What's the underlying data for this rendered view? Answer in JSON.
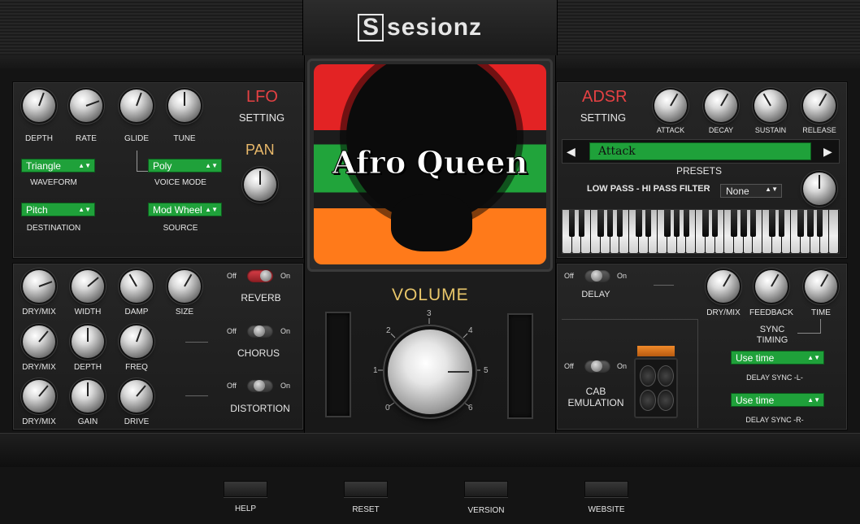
{
  "brand": {
    "logo_s": "S",
    "logo_text": "sesionz"
  },
  "lfo": {
    "title": "LFO",
    "subtitle": "SETTING",
    "knobs": [
      "DEPTH",
      "RATE",
      "GLIDE",
      "TUNE"
    ],
    "waveform_value": "Triangle",
    "waveform_label": "WAVEFORM",
    "voice_value": "Poly",
    "voice_label": "VOICE MODE",
    "destination_value": "Pitch",
    "destination_label": "DESTINATION",
    "source_value": "Mod Wheel",
    "source_label": "SOURCE",
    "pan_label": "PAN"
  },
  "artwork": {
    "title": "Afro Queen"
  },
  "volume": {
    "label": "VOLUME",
    "ticks": [
      "0",
      "1",
      "2",
      "3",
      "4",
      "5",
      "6"
    ]
  },
  "adsr": {
    "title": "ADSR",
    "subtitle": "SETTING",
    "knobs": [
      "ATTACK",
      "DECAY",
      "SUSTAIN",
      "RELEASE"
    ],
    "preset_value": "Attack",
    "presets_label": "PRESETS",
    "filter_label": "LOW PASS - HI PASS FILTER",
    "filter_value": "None"
  },
  "fx": {
    "off": "Off",
    "on": "On",
    "reverb": {
      "label": "REVERB",
      "knobs": [
        "DRY/MIX",
        "WIDTH",
        "DAMP",
        "SIZE"
      ]
    },
    "chorus": {
      "label": "CHORUS",
      "knobs": [
        "DRY/MIX",
        "DEPTH",
        "FREQ"
      ]
    },
    "distortion": {
      "label": "DISTORTION",
      "knobs": [
        "DRY/MIX",
        "GAIN",
        "DRIVE"
      ]
    }
  },
  "delay": {
    "label": "DELAY",
    "knobs": [
      "DRY/MIX",
      "FEEDBACK",
      "TIME"
    ],
    "sync_label_1": "SYNC",
    "sync_label_2": "TIMING",
    "sync_l_value": "Use time",
    "sync_l_label": "DELAY SYNC -L-",
    "sync_r_value": "Use time",
    "sync_r_label": "DELAY SYNC -R-"
  },
  "cab": {
    "label_1": "CAB",
    "label_2": "EMULATION"
  },
  "footer": {
    "help": "HELP",
    "reset": "RESET",
    "version": "VERSION",
    "website": "WEBSITE"
  },
  "colors": {
    "accent_red": "#e54143",
    "select_green": "#1fa13a",
    "volume_gold": "#e8c66a",
    "pan_gold": "#e8b86a"
  }
}
